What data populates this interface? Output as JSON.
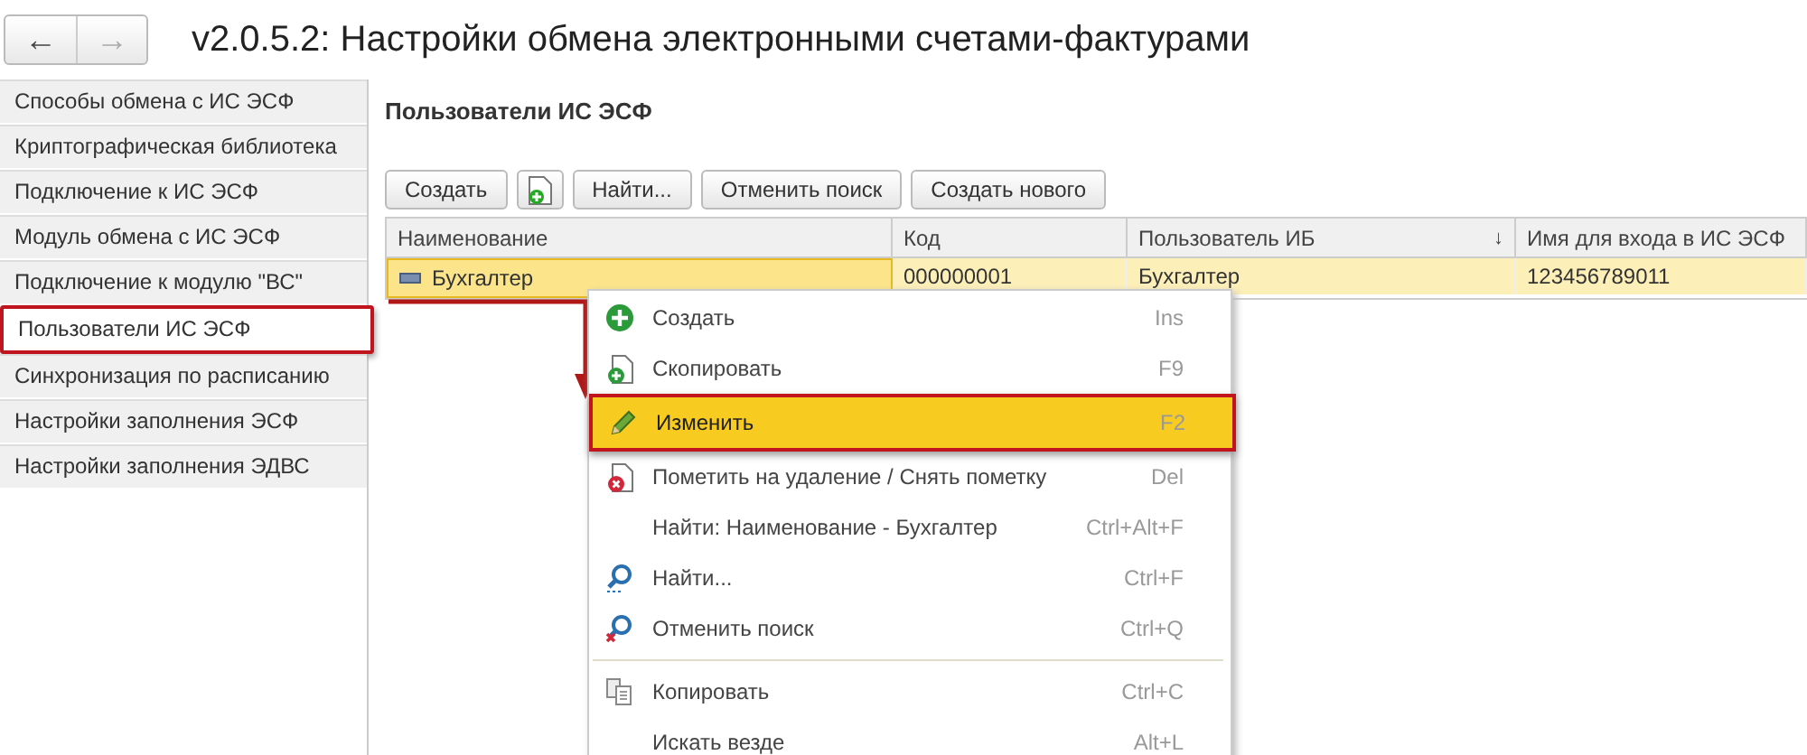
{
  "window": {
    "title": "v2.0.5.2: Настройки обмена электронными счетами-фактурами"
  },
  "nav": {
    "back": "←",
    "forward": "→",
    "forward_disabled": true
  },
  "sidebar": {
    "items": [
      {
        "label": "Способы обмена с ИС ЭСФ",
        "selected": false
      },
      {
        "label": "Криптографическая библиотека",
        "selected": false
      },
      {
        "label": "Подключение к ИС ЭСФ",
        "selected": false
      },
      {
        "label": "Модуль обмена с ИС ЭСФ",
        "selected": false
      },
      {
        "label": "Подключение к модулю \"ВС\"",
        "selected": false
      },
      {
        "label": "Пользователи ИС ЭСФ",
        "selected": true
      },
      {
        "label": "Синхронизация по расписанию",
        "selected": false
      },
      {
        "label": "Настройки заполнения ЭСФ",
        "selected": false
      },
      {
        "label": "Настройки заполнения ЭДВС",
        "selected": false
      }
    ]
  },
  "section_title": "Пользователи ИС ЭСФ",
  "toolbar": [
    {
      "kind": "text",
      "label": "Создать"
    },
    {
      "kind": "icon"
    },
    {
      "kind": "text",
      "label": "Найти..."
    },
    {
      "kind": "text",
      "label": "Отменить поиск"
    },
    {
      "kind": "text",
      "label": "Создать нового"
    }
  ],
  "table": {
    "columns": [
      {
        "label": "Наименование"
      },
      {
        "label": "Код"
      },
      {
        "label": "Пользователь ИБ",
        "sort_mark": "↓"
      },
      {
        "label": "Имя для входа в ИС ЭСФ"
      }
    ],
    "rows": [
      {
        "selected": true,
        "cells": [
          "Бухгалтер",
          "000000001",
          "Бухгалтер",
          "123456789011"
        ]
      }
    ]
  },
  "context_menu": {
    "groups": [
      [
        {
          "label": "Создать",
          "shortcut": "Ins",
          "selected": false
        },
        {
          "label": "Скопировать",
          "shortcut": "F9",
          "selected": false
        },
        {
          "label": "Изменить",
          "shortcut": "F2",
          "selected": true
        },
        {
          "label": "Пометить на удаление / Снять пометку",
          "shortcut": "Del",
          "selected": false
        },
        {
          "label": "Найти: Наименование - Бухгалтер",
          "shortcut": "Ctrl+Alt+F",
          "selected": false
        },
        {
          "label": "Найти...",
          "shortcut": "Ctrl+F",
          "selected": false
        },
        {
          "label": "Отменить поиск",
          "shortcut": "Ctrl+Q",
          "selected": false
        }
      ],
      [
        {
          "label": "Копировать",
          "shortcut": "Ctrl+C",
          "selected": false
        },
        {
          "label": "Искать везде",
          "shortcut": "Alt+L",
          "selected": false
        }
      ]
    ]
  }
}
